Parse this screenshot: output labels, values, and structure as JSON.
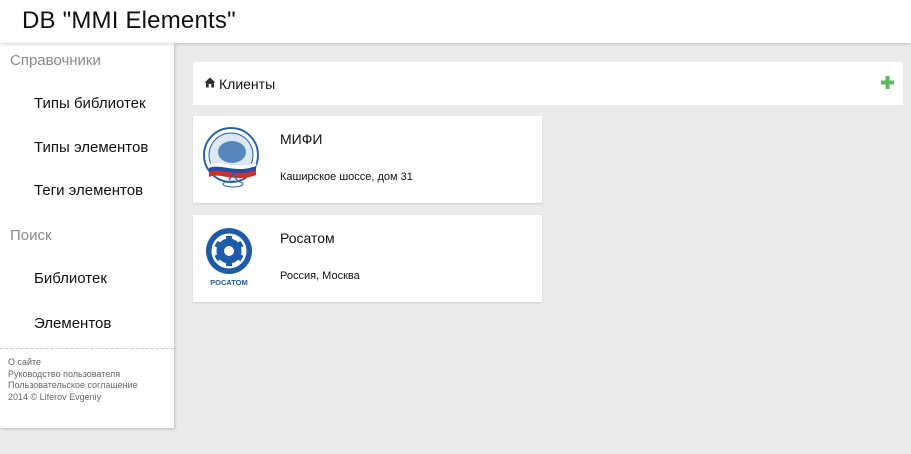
{
  "app": {
    "title": "DB \"MMI Elements\""
  },
  "sidebar": {
    "sections": [
      {
        "title": "Справочники",
        "items": [
          "Типы библиотек",
          "Типы элементов",
          "Теги элементов"
        ]
      },
      {
        "title": "Поиск",
        "items": [
          "Библиотек",
          "Элементов"
        ]
      }
    ],
    "footer": {
      "links": [
        "О сайте",
        "Руководство пользователя",
        "Пользовательское соглашение"
      ],
      "copyright": "2014 © Liferov Evgeniy"
    }
  },
  "panel": {
    "title": "Клиенты",
    "icons": {
      "title_icon": "home-icon",
      "add_icon": "plus-icon"
    },
    "add_color": "#5cb85c"
  },
  "clients": [
    {
      "name": "МИФИ",
      "address": "Каширское шоссе, дом 31",
      "logo": "mephi-logo"
    },
    {
      "name": "Росатом",
      "address": "Россия, Москва",
      "logo": "rosatom-logo",
      "logo_text": "РОСАТОМ"
    }
  ]
}
